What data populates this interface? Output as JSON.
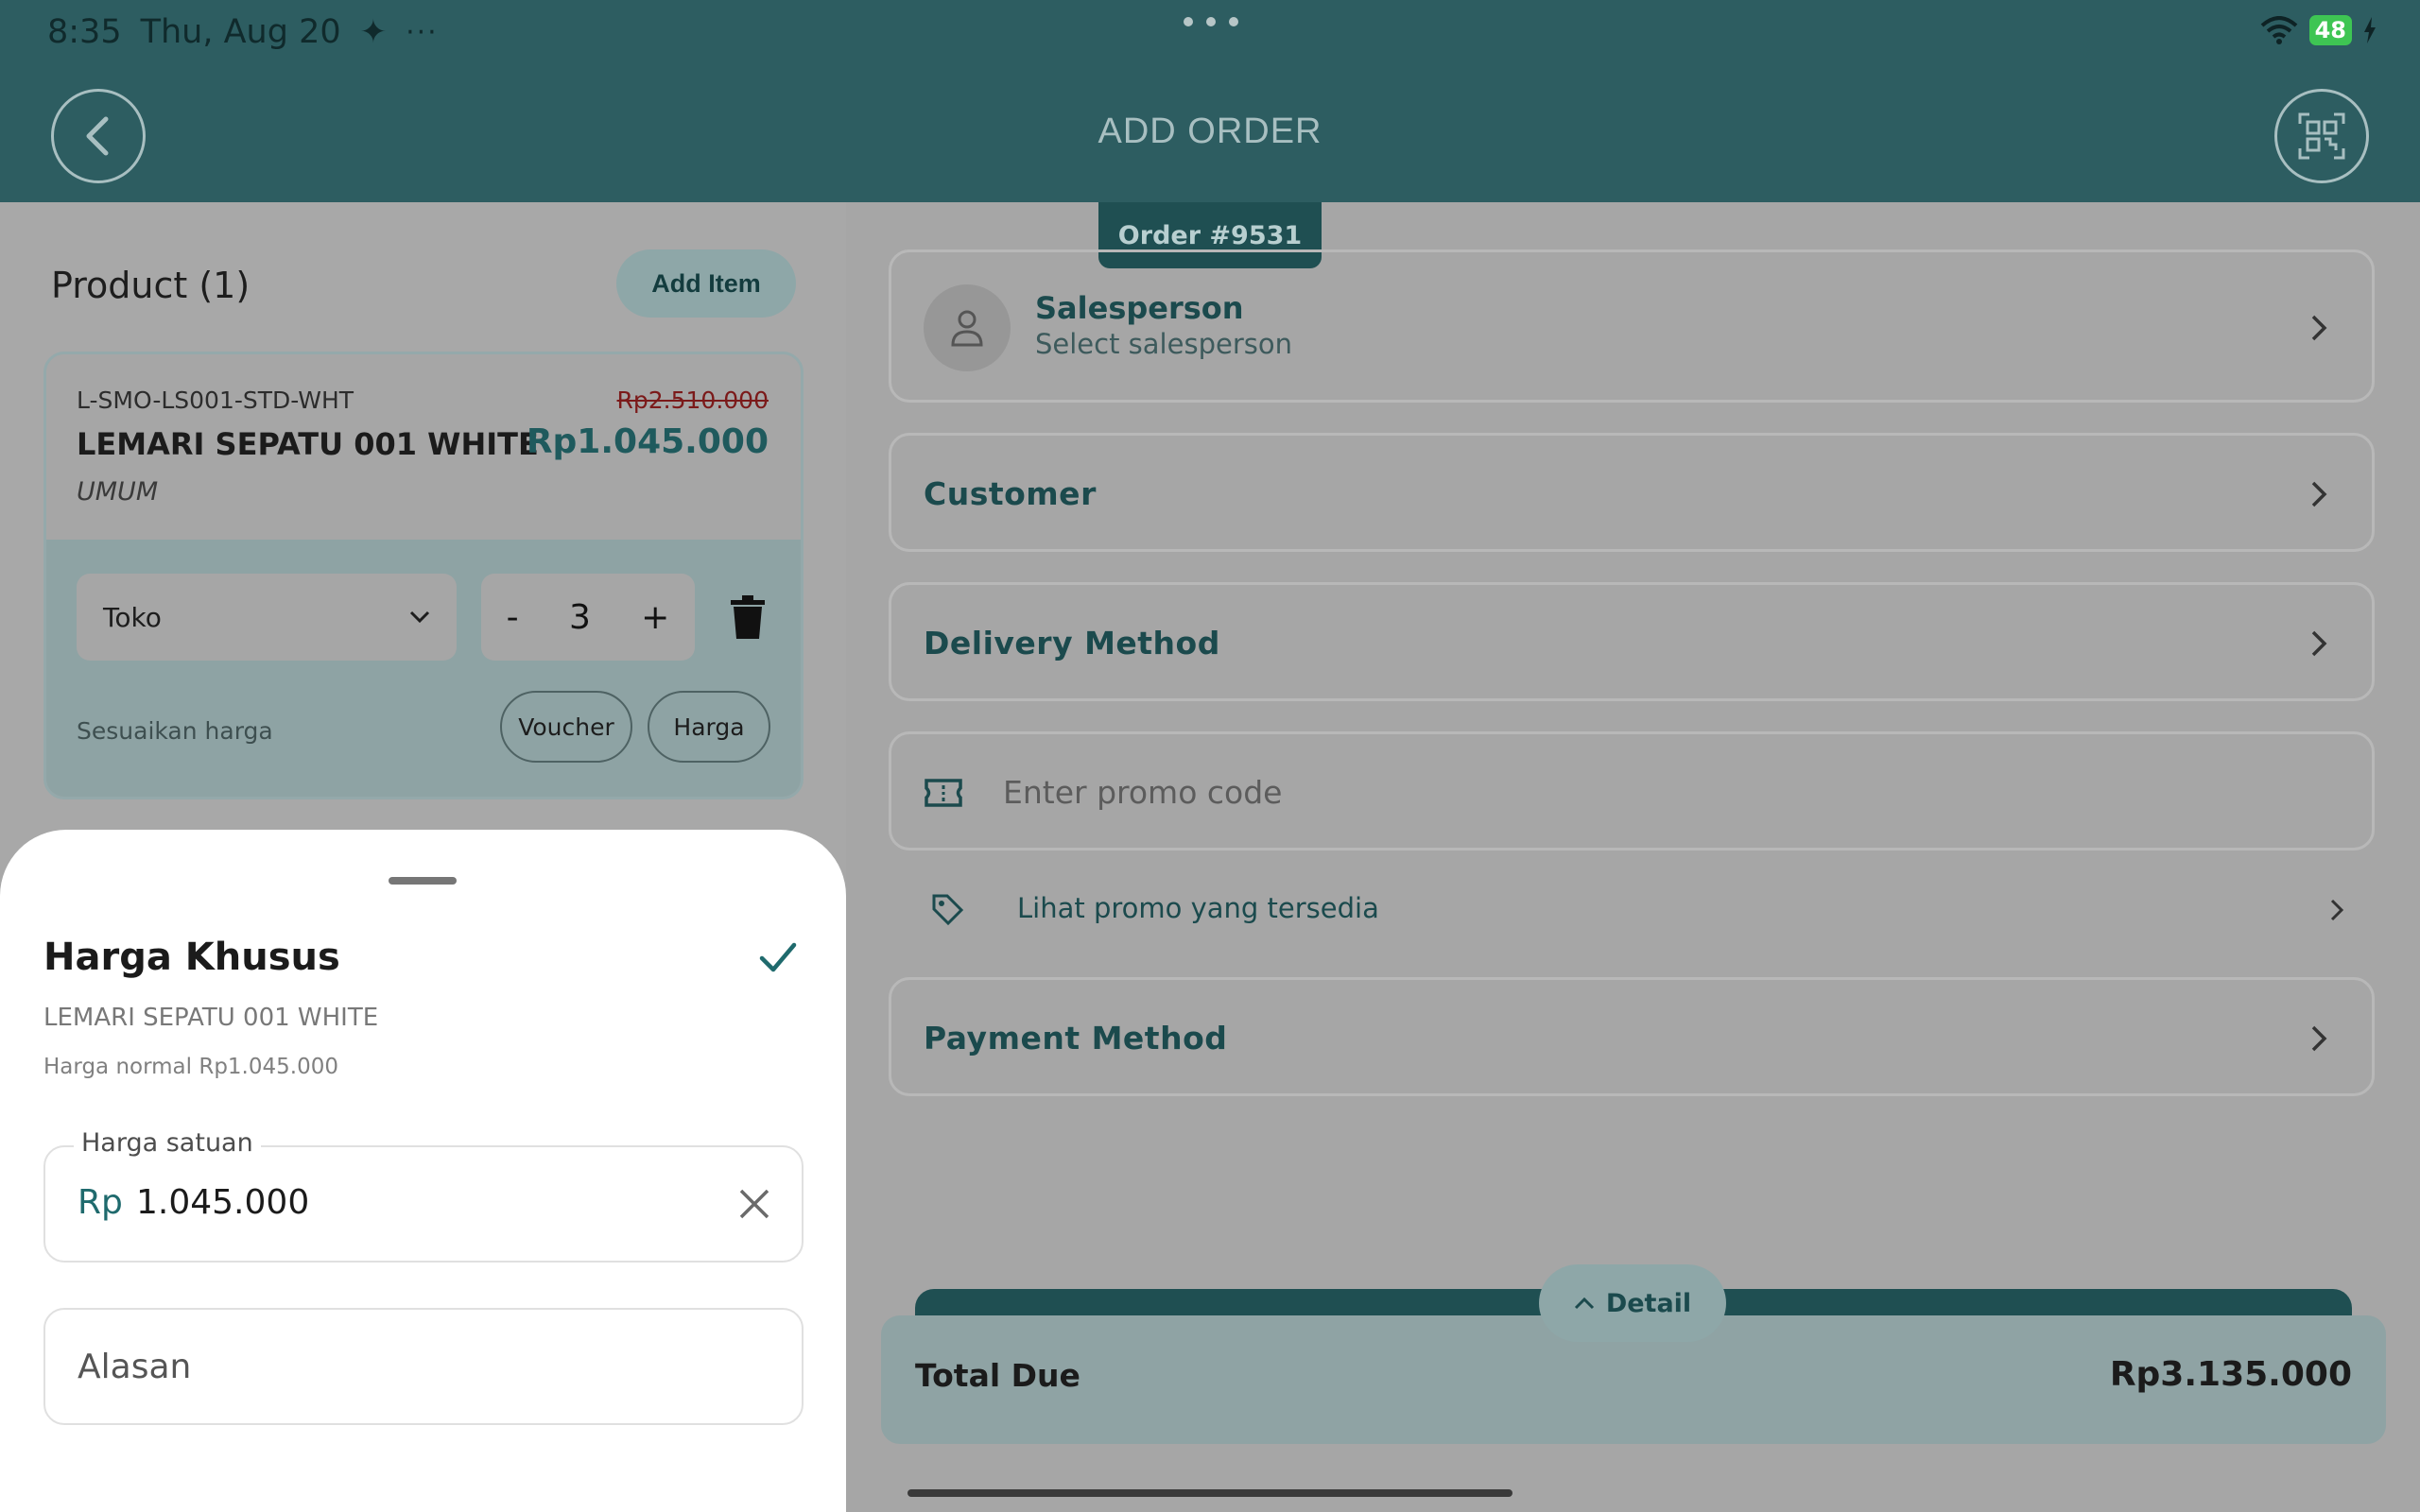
{
  "status_bar": {
    "time": "8:35",
    "date": "Thu, Aug 20",
    "battery": "48"
  },
  "header": {
    "title": "ADD ORDER",
    "order_tab": "Order #9531"
  },
  "products": {
    "title": "Product (1)",
    "add_item_label": "Add Item",
    "items": [
      {
        "sku": "L-SMO-LS001-STD-WHT",
        "name": "LEMARI SEPATU 001 WHITE",
        "category": "UMUM",
        "original_price": "Rp2.510.000",
        "price": "Rp1.045.000",
        "store": "Toko",
        "qty_minus": "-",
        "qty": "3",
        "qty_plus": "+",
        "adjust_label": "Sesuaikan harga",
        "voucher_label": "Voucher",
        "harga_label": "Harga"
      }
    ]
  },
  "sheet": {
    "title": "Harga Khusus",
    "product_name": "LEMARI SEPATU 001 WHITE",
    "normal_price": "Harga normal Rp1.045.000",
    "unit_price_label": "Harga satuan",
    "currency": "Rp",
    "unit_price_value": "1.045.000",
    "reason_placeholder": "Alasan"
  },
  "order": {
    "salesperson_title": "Salesperson",
    "salesperson_sub": "Select salesperson",
    "customer": "Customer",
    "delivery": "Delivery Method",
    "promo_placeholder": "Enter promo code",
    "promo_link": "Lihat promo yang tersedia",
    "payment": "Payment Method",
    "detail_label": "Detail",
    "total_label": "Total Due",
    "total_value": "Rp3.135.000"
  },
  "colors": {
    "header": "#2d5d61",
    "accent": "#1f4f52",
    "sheet": "#ffffff"
  },
  "icons": [
    "back-arrow-icon",
    "qr-scan-icon",
    "chevron-down-icon",
    "trash-icon",
    "check-icon",
    "close-icon",
    "person-icon",
    "chevron-right-icon",
    "ticket-icon",
    "tag-icon",
    "chevron-up-icon",
    "wifi-icon"
  ]
}
